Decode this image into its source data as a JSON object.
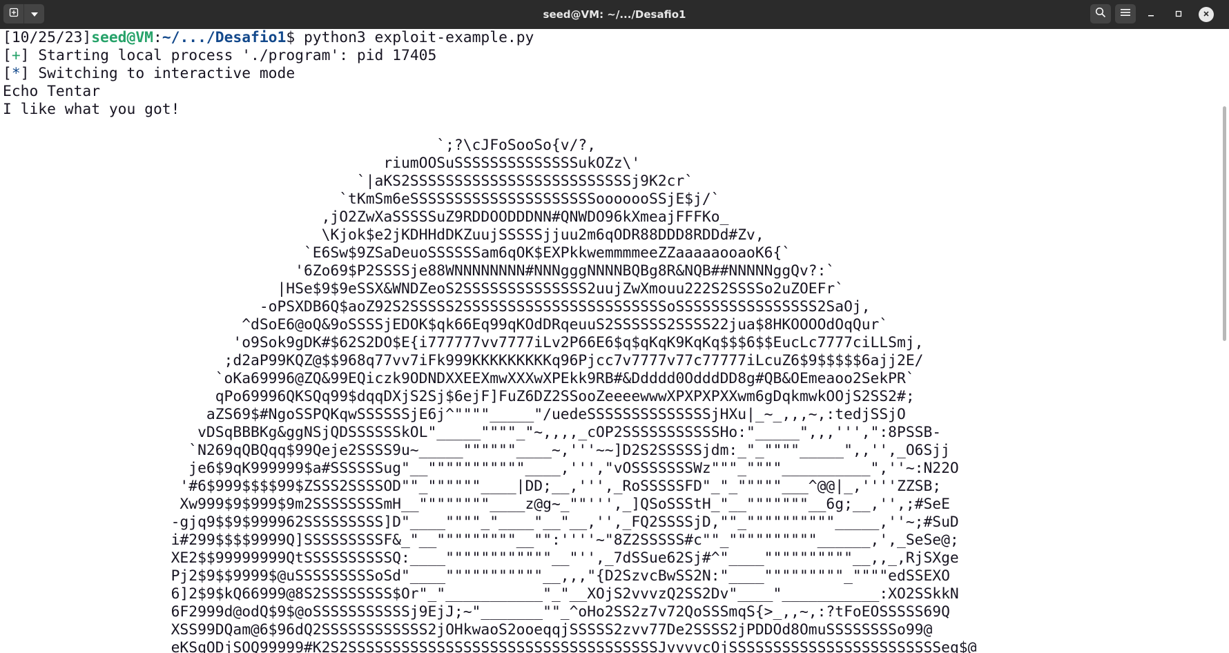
{
  "window": {
    "title": "seed@VM: ~/.../Desafio1"
  },
  "icons": {
    "new_tab": "new-tab-icon",
    "menu_dropdown": "chevron-down-icon",
    "search": "search-icon",
    "hamburger": "hamburger-menu-icon",
    "minimize": "minimize-icon",
    "maximize": "maximize-icon",
    "close": "close-icon"
  },
  "colors": {
    "prompt_user": "#26a269",
    "prompt_path": "#12488b",
    "text": "#171421",
    "background": "#ffffff",
    "titlebar": "#2b2b2b"
  },
  "prompt": {
    "date": "[10/25/23]",
    "user": "seed@VM",
    "colon": ":",
    "path": "~/.../Desafio1",
    "dollar": "$ ",
    "command": "python3 exploit-example.py"
  },
  "status": [
    {
      "open": "[",
      "mark": "+",
      "close": "] ",
      "text": "Starting local process './program': pid 17405"
    },
    {
      "open": "[",
      "mark": "*",
      "close": "] ",
      "text": "Switching to interactive mode"
    }
  ],
  "output": [
    "Echo Tentar",
    "I like what you got!",
    ""
  ],
  "ascii_art": [
    "                                                 `;?\\cJFoSooSo{v/?,",
    "                                           riumOOSuSSSSSSSSSSSSSSukOZz\\'",
    "                                        `|aKS2SSSSSSSSSSSSSSSSSSSSSSSSSj9K2cr`",
    "                                      `tKmSm6eSSSSSSSSSSSSSSSSSSSSSooooooSSjE$j/`",
    "                                    ,jO2ZwXaSSSSSuZ9RDDOODDDNN#QNWDO96kXmeajFFFKo_",
    "                                    \\Kjok$e2jKDHHdDKZuujSSSSSjjuu2m6qODR88DDD8RDDd#Zv,",
    "                                  `E6Sw$9ZSaDeuoSSSSSSam6qOK$EXPkkwemmmmeeZZaaaaaooaoK6{`",
    "                                 '6Zo69$P2SSSSje88WNNNNNNNN#NNNgggNNNNBQBg8R&NQB##NNNNNggQv?:`",
    "                               |HSe$9$9eSSX&WNDZeoS2SSSSSSSSSSSSSS2uujZwXmouu222S2SSSSo2uZOEFr`",
    "                             -oPSXDB6Q$aoZ92S2SSSSS2SSSSSSSSSSSSSSSSSSSSSSSoSSSSSSSSSSSSSSSS2SaOj,",
    "                           ^dSoE6@oQ&9oSSSSjEDOK$qk66Eq99qKOdDRqeuuS2SSSSSS2SSSS22jua$8HKOOOOdOqQur`",
    "                          'o9Sok9gDK#$62S2DO$E{i777777vv7777iLv2P66E6$q$qKqK9KqKq$$$6$$EucLc7777ciLLSmj,",
    "                         ;d2aP99KQZ@$$968q77vv7iFk999KKKKKKKKKq96Pjcc7v7777v77c77777iLcuZ6$9$$$$$6ajj2E/",
    "                        `oKa69996@ZQ&99EQiczk9ODNDXXEEXmwXXXwXPEkk9RB#&Ddddd0OdddDD8g#QB&OEmeaoo2SekPR`",
    "                        qPo69996QKSQq99$dqqDXjS2Sj$6ejF]FuZ6DZ2SSooZeeeewwwXPXPXPXXwm6gDqkmwkOOjS2SS2#;",
    "                       aZS69$#NgoSSPQKqwSSSSSSjE6j^\"\"\"\"_____\"/uedeSSSSSSSSSSSSSSjHXu|_~_,,,~,:tedjSSjO",
    "                      vDSqBBBKg&ggNSjQDSSSSSSkOL\"_____\"\"\"\"_\"~,,,,_cOP2SSSSSSSSSSSHo:\"_____\",,,''',\":8PSSB-",
    "                     `N269qQBQqq$99Qeje2SSSS9u~_____\"\"\"\"\"\"____~,'''~~]D2S2SSSSSjdm:_\"_\"\"\"\"_____\",,'',_O6Sjj",
    "                     je6$9qK999999$a#SSSSSSug\"__\"\"\"\"\"\"\"\"\"\"\"____,''',\"vOSSSSSSSWz\"\"\"_\"\"\"\"__________\",''~:N22O",
    "                    '#6$999$$$$99$ZSSS2SSSSOD\"\"_\"\"\"\"\"\"____|DD;__,''',_RoSSSSSFD\"_\"_\"\"\"\"\"___^@@|_,''''ZZSB;",
    "                    Xw999$9$999$9m2SSSSSSSSmH__\"\"\"\"\"\"\"\"____z@g~_\"\"''',_]QSoSSStH_\"__\"\"\"\"\"\"\"__6g;__,'',;#SeE",
    "                   -gjq9$$9$999962SSSSSSSSS]D\"____\"\"\"\"_\"____\"__\"__,'',_FQ2SSSSjD,\"\"_\"\"\"\"\"\"\"\"\"\"_____,''~;#SuD",
    "                   i#299$$$$9999Q]SSSSSSSSSF&_\"__\"\"\"\"\"\"\"\"\"__\"\":''''~\"8Z2SSSSS#c\"\"_\"\"\"\"\"\"\"\"\"\"______,',_SeSe@;",
    "                   XE2$$99999999QtSSSSSSSSSSQ:____\"\"\"\"\"\"\"\"\"\"\"\"__\"'',_7dSSue62Sj#^\"____\"\"\"\"\"\"\"\"\"\"__,,_,RjSXge",
    "                   Pj2$9$$9999$@uSSSSSSSSSoSd\"____\"\"\"\"\"\"\"\"\"\"\"__,,,\"{D2SzvcBwSS2N:\"____\"\"\"\"\"\"\"\"\"_\"\"\"\"edSSEXO",
    "                   6]2$9$kQ66999@8S2SSSSSSSS$Or\"_\"___________\"_\"__XOjS2vvvzQ2SS2Dv\"____\"___________:XO2SSkkN",
    "                   6F2999d@odQ$9$@oSSSSSSSSSSSj9EjJ;~\"_______\"\"_^oHo2SS2z7v72QoSSSmqS{>_,,~,:?tFoEOSSSSS69Q",
    "                   XSS99DQam@6$96dQ2SSSSSSSSSSSS2jOHkwaoS2ooeqqjSSSSS2zvv77De2SSSS2jPDDOd8OmuSSSSSSSSo99@",
    "                   eKSqODjSOQ99999#K2S2SSSSSSSSSSSSSSSSSSSSSSSSSSSSSSSSSSSJvvvvcOjSSSSSSSSSSSSSSSSSSSSSSSSeq$@"
  ]
}
